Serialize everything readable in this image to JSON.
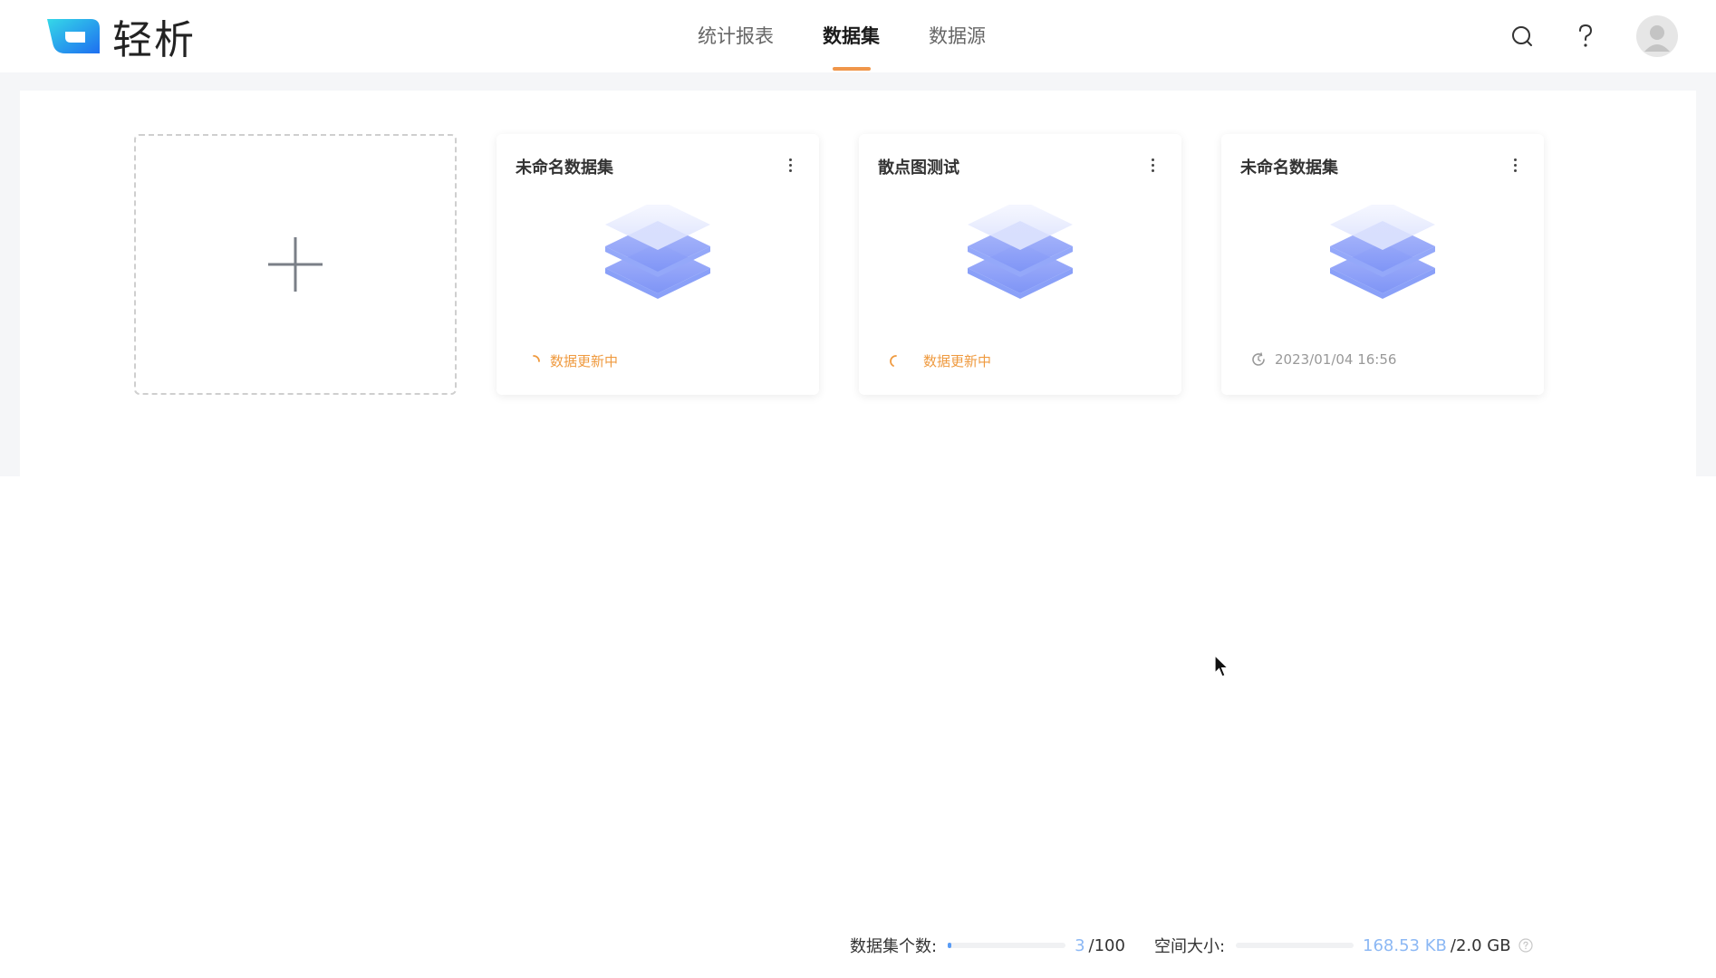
{
  "app": {
    "name": "轻析"
  },
  "nav": {
    "tabs": [
      {
        "label": "统计报表",
        "active": false
      },
      {
        "label": "数据集",
        "active": true
      },
      {
        "label": "数据源",
        "active": false
      }
    ]
  },
  "header_icons": [
    "search-icon",
    "help-icon",
    "avatar"
  ],
  "cards": [
    {
      "title": "未命名数据集",
      "status_type": "updating",
      "status": "数据更新中"
    },
    {
      "title": "散点图测试",
      "status_type": "updating",
      "status": "数据更新中"
    },
    {
      "title": "未命名数据集",
      "status_type": "time",
      "status": "2023/01/04 16:56"
    }
  ],
  "footer": {
    "count_label": "数据集个数:",
    "count_value": "3",
    "count_total": "/100",
    "count_fraction": 0.03,
    "space_label": "空间大小:",
    "space_value": "168.53 KB",
    "space_total": "/2.0 GB",
    "space_fraction": 0.0001
  },
  "colors": {
    "accent": "#f0964a",
    "updating": "#ef9a3f",
    "link_blue": "#8cb8f4",
    "bar_fill": "#5a9cf5"
  }
}
